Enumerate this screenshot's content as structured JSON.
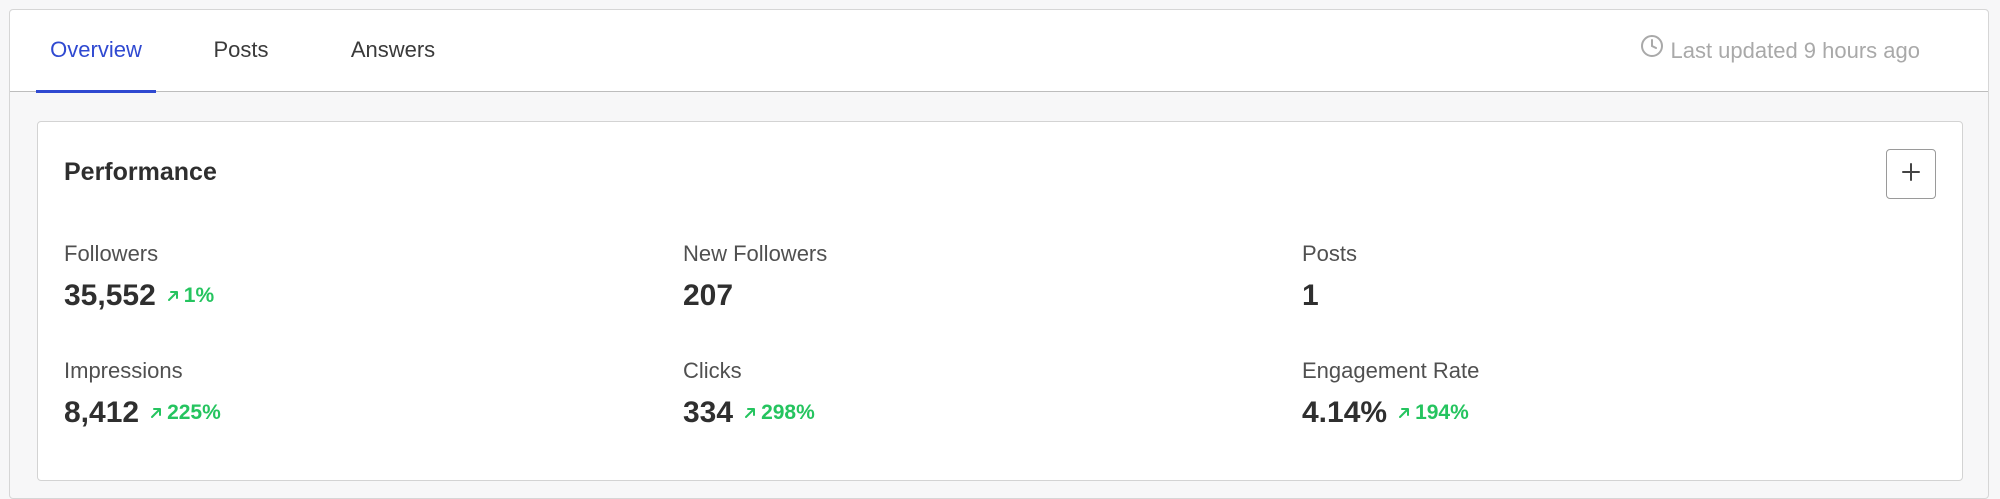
{
  "tabs": [
    {
      "label": "Overview",
      "active": true
    },
    {
      "label": "Posts",
      "active": false
    },
    {
      "label": "Answers",
      "active": false
    }
  ],
  "status": {
    "icon": "clock-icon",
    "text": "Last updated 9 hours ago"
  },
  "card": {
    "title": "Performance",
    "add_button_icon": "plus-icon"
  },
  "metrics": [
    {
      "label": "Followers",
      "value": "35,552",
      "change": "1%"
    },
    {
      "label": "New Followers",
      "value": "207",
      "change": ""
    },
    {
      "label": "Posts",
      "value": "1",
      "change": ""
    },
    {
      "label": "Impressions",
      "value": "8,412",
      "change": "225%"
    },
    {
      "label": "Clicks",
      "value": "334",
      "change": "298%"
    },
    {
      "label": "Engagement Rate",
      "value": "4.14%",
      "change": "194%"
    }
  ],
  "colors": {
    "accent": "#2f49d1",
    "positive": "#25c45f",
    "muted": "#a9a9a9"
  }
}
